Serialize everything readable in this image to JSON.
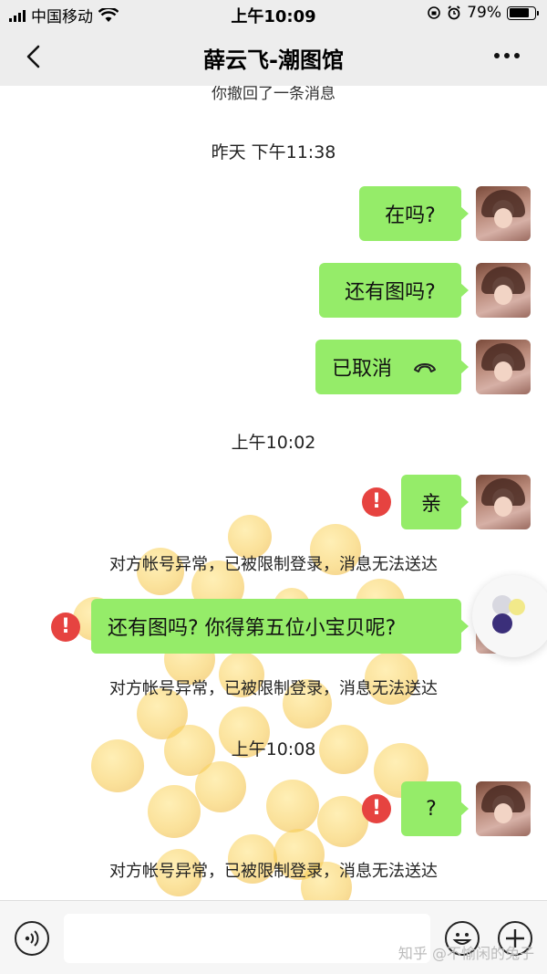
{
  "status_bar": {
    "carrier": "中国移动",
    "time": "上午10:09",
    "battery_percent": "79%",
    "battery_level": 0.79
  },
  "nav": {
    "title": "薛云飞-潮图馆",
    "back_icon": "chevron-left-icon",
    "more_icon": "more-dots-icon"
  },
  "chat": {
    "recalled_notice": "你撤回了一条消息",
    "timestamps": [
      "昨天 下午11:38",
      "上午10:02",
      "上午10:08"
    ],
    "messages": [
      {
        "text": "在吗?",
        "side": "right"
      },
      {
        "text": "还有图吗?",
        "side": "right"
      },
      {
        "text": "已取消",
        "side": "right",
        "icon": "call-cancelled-icon"
      },
      {
        "text": "亲",
        "side": "right",
        "failed": true
      },
      {
        "text": "还有图吗? 你得第五位小宝贝呢?",
        "side": "right",
        "failed": true
      },
      {
        "text": "?",
        "side": "right",
        "failed": true
      }
    ],
    "error_symbol": "!",
    "system_notice": "对方帐号异常，已被限制登录，消息无法送达"
  },
  "input_bar": {
    "voice_icon": "voice-icon",
    "emoji_icon": "emoji-icon",
    "plus_icon": "plus-icon",
    "value": ""
  },
  "watermark": "知乎 @不愉闲的兔子",
  "colors": {
    "bubble": "#95ec69",
    "error": "#e64340",
    "nav_bg": "#ededed"
  }
}
